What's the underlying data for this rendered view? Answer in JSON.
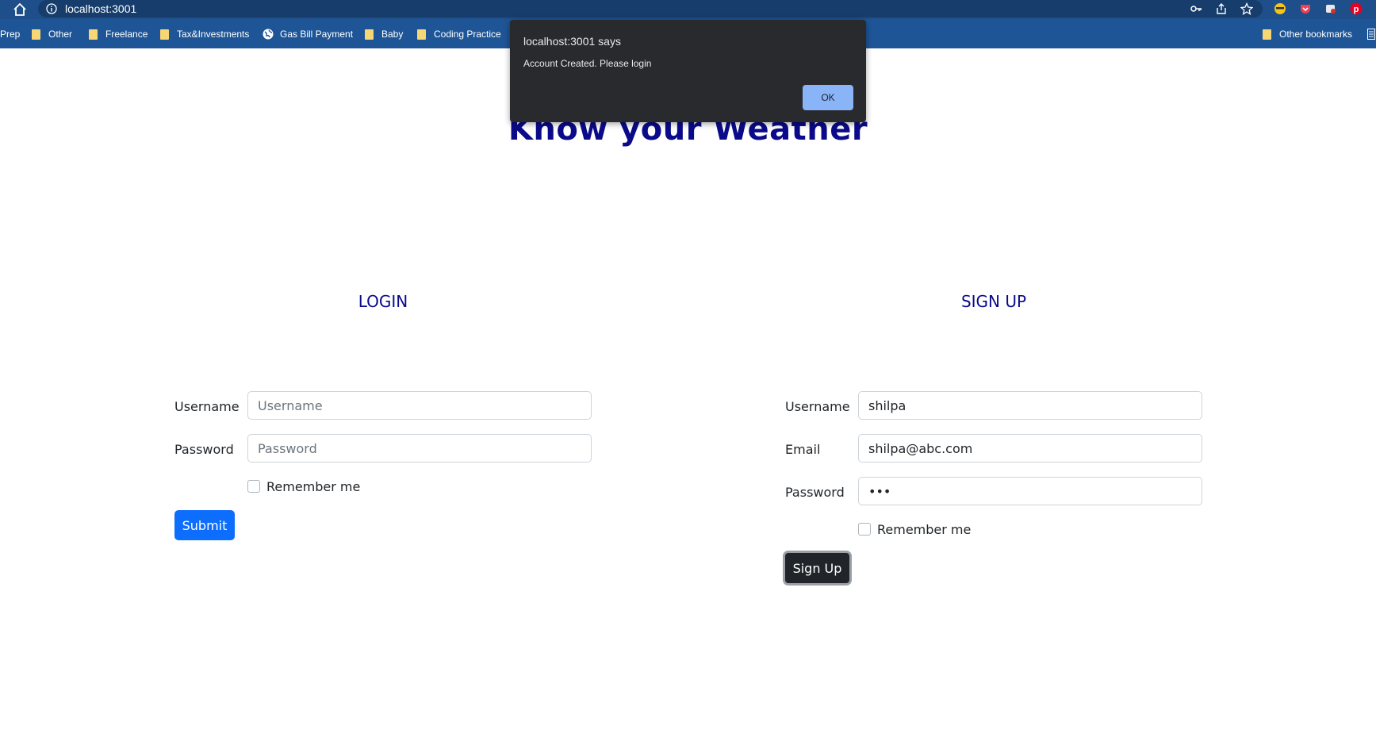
{
  "browser": {
    "url": "localhost:3001",
    "bookmarks": [
      {
        "label": "Prep",
        "icon": "folder-icon"
      },
      {
        "label": "Other",
        "icon": "folder-icon"
      },
      {
        "label": "Freelance",
        "icon": "folder-icon"
      },
      {
        "label": "Tax&Investments",
        "icon": "folder-icon"
      },
      {
        "label": "Gas Bill Payment",
        "icon": "globe-icon"
      },
      {
        "label": "Baby",
        "icon": "folder-icon"
      },
      {
        "label": "Coding Practice",
        "icon": "folder-icon"
      }
    ],
    "other_bookmarks": "Other bookmarks",
    "toolbar_colors": {
      "frame": "#1e4f8a",
      "bookmarks_bar": "#1e5597"
    }
  },
  "page": {
    "title": "Know your Weather",
    "login": {
      "heading": "LOGIN",
      "username_label": "Username",
      "username_placeholder": "Username",
      "password_label": "Password",
      "password_placeholder": "Password",
      "remember_label": "Remember me",
      "submit_label": "Submit"
    },
    "signup": {
      "heading": "SIGN UP",
      "username_label": "Username",
      "username_value": "shilpa",
      "email_label": "Email",
      "email_value": "shilpa@abc.com",
      "password_label": "Password",
      "password_value": "abc",
      "remember_label": "Remember me",
      "signup_label": "Sign Up"
    },
    "colors": {
      "heading": "#0a0a8a",
      "primary": "#0d6efd",
      "dark": "#212529"
    }
  },
  "dialog": {
    "origin": "localhost:3001 says",
    "message": "Account Created. Please login",
    "ok_label": "OK"
  }
}
